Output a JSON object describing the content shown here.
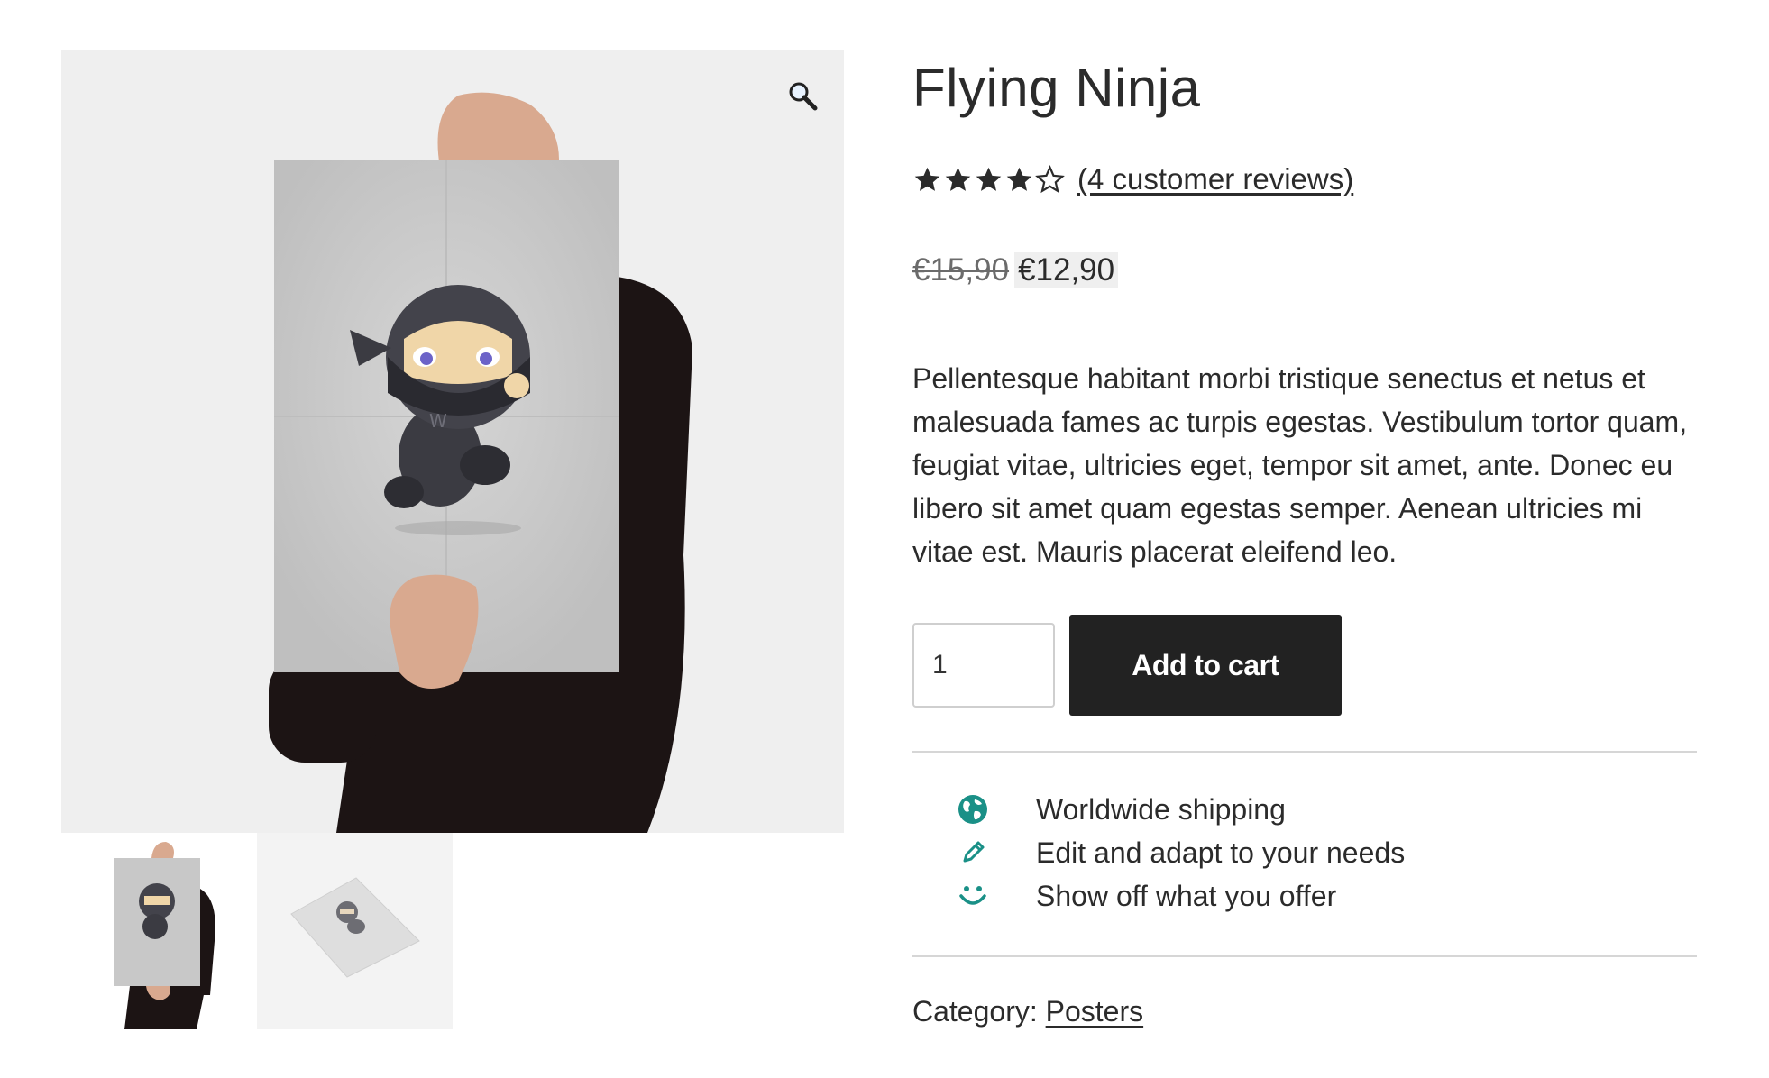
{
  "product": {
    "title": "Flying Ninja",
    "rating": {
      "value": 4,
      "max": 5,
      "review_link": "(4 customer reviews)"
    },
    "price": {
      "regular": "€15,90",
      "sale": "€12,90"
    },
    "description": "Pellentesque habitant morbi tristique senectus et netus et malesuada fames ac turpis egestas. Vestibulum tortor quam, feugiat vitae, ultricies eget, tempor sit amet, ante. Donec eu libero sit amet quam egestas semper. Aenean ultricies mi vitae est. Mauris placerat eleifend leo.",
    "quantity": "1",
    "add_to_cart_label": "Add to cart",
    "category_label": "Category:",
    "category": "Posters"
  },
  "features": [
    {
      "icon": "globe-icon",
      "label": "Worldwide shipping"
    },
    {
      "icon": "pencil-icon",
      "label": "Edit and adapt to your needs"
    },
    {
      "icon": "smile-icon",
      "label": "Show off what you offer"
    }
  ],
  "gallery": {
    "zoom_icon": "magnifier-icon",
    "thumbnails": [
      "ninja-poster-held-thumbnail",
      "ninja-poster-flat-thumbnail"
    ]
  },
  "colors": {
    "accent": "#1a9087",
    "button": "#222222",
    "text": "#333333",
    "divider": "#d6d6d6"
  }
}
